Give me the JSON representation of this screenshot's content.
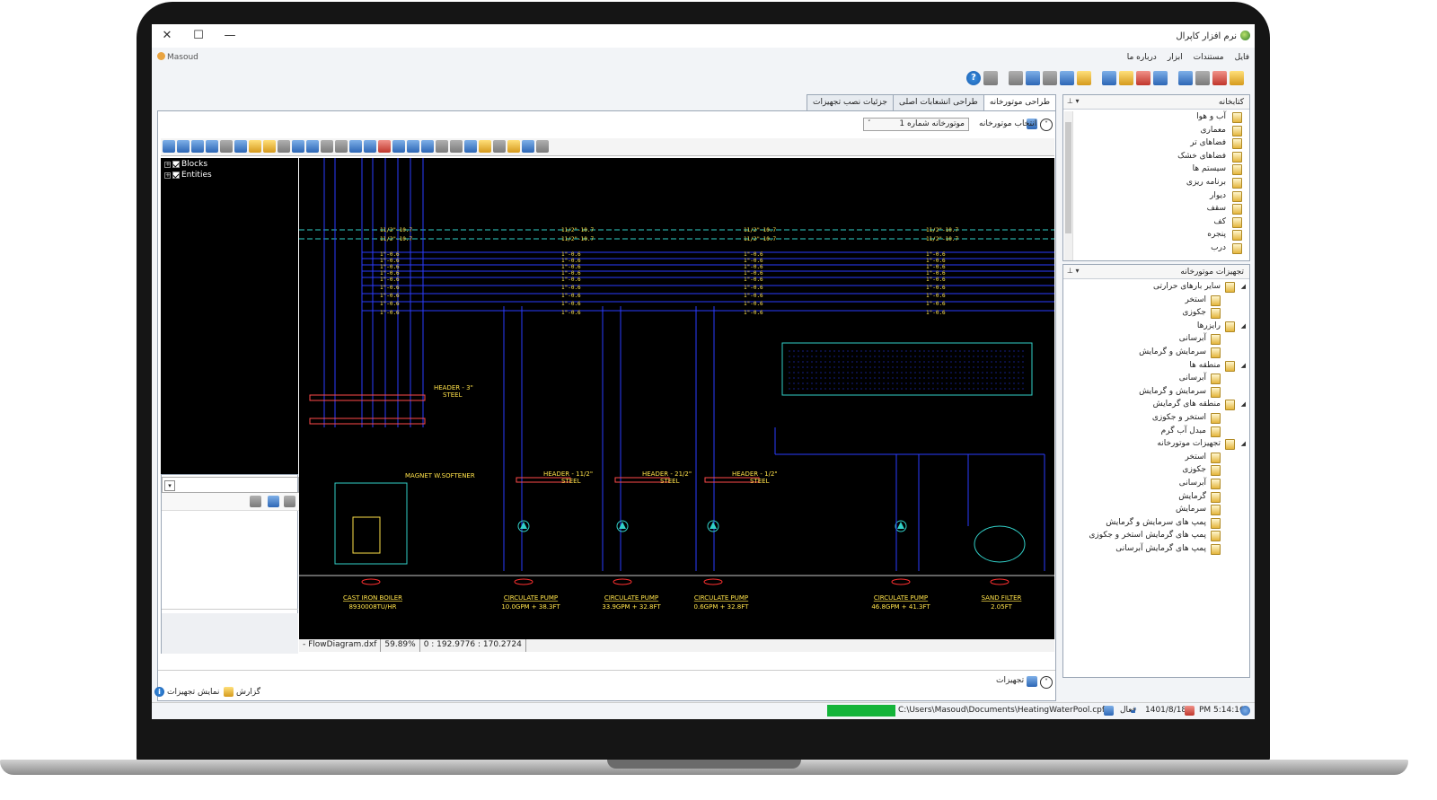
{
  "window": {
    "title": "نرم افزار کاپرال",
    "controls": {
      "close": "✕",
      "maximize": "☐",
      "minimize": "—"
    }
  },
  "user": {
    "name": "Masoud"
  },
  "menu": [
    "فایل",
    "مستندات",
    "ابزار",
    "درباره ما"
  ],
  "tabs": [
    "طراحی موتورخانه",
    "طراحی انشعابات اصلی",
    "جزئیات نصب تجهیزات"
  ],
  "library_panel": {
    "title": "کتابخانه",
    "items": [
      "آب و هوا",
      "معماری",
      "فضاهای تر",
      "فضاهای خشک",
      "سیستم ها",
      "برنامه ریزی",
      "دیوار",
      "سقف",
      "کف",
      "پنجره",
      "درب"
    ]
  },
  "equipment_panel": {
    "title": "تجهیزات موتورخانه",
    "items": [
      {
        "label": "سایر بارهای حرارتی",
        "level": 0
      },
      {
        "label": "استخر",
        "level": 1
      },
      {
        "label": "جکوزی",
        "level": 1
      },
      {
        "label": "رایزرها",
        "level": 0
      },
      {
        "label": "آبرسانی",
        "level": 1
      },
      {
        "label": "سرمایش و گرمایش",
        "level": 1
      },
      {
        "label": "منطقه ها",
        "level": 0
      },
      {
        "label": "آبرسانی",
        "level": 1
      },
      {
        "label": "سرمایش و گرمایش",
        "level": 1
      },
      {
        "label": "منطقه های گرمایش",
        "level": 0
      },
      {
        "label": "استخر و جکوزی",
        "level": 1
      },
      {
        "label": "مبدل آب گرم",
        "level": 1
      },
      {
        "label": "تجهیزات موتورخانه",
        "level": 0
      },
      {
        "label": "استخر",
        "level": 1
      },
      {
        "label": "جکوزی",
        "level": 1
      },
      {
        "label": "آبرسانی",
        "level": 1
      },
      {
        "label": "گرمایش",
        "level": 1
      },
      {
        "label": "سرمایش",
        "level": 1
      },
      {
        "label": "پمپ های سرمایش و گرمایش",
        "level": 1
      },
      {
        "label": "پمپ های گرمایش استخر و جکوزی",
        "level": 1
      },
      {
        "label": "پمپ های گرمایش آبرسانی",
        "level": 1
      }
    ]
  },
  "select_plant": {
    "label": "انتخاب موتورخانه",
    "value": "موتورخانه شماره 1"
  },
  "layers": [
    "Blocks",
    "Entities"
  ],
  "cad_status": {
    "file": "- FlowDiagram.dxf",
    "zoom": "59.89%",
    "coords": "0 : 192.9776 : 170.2724"
  },
  "equipment_row_label": "تجهیزات",
  "footer": {
    "show_equipment": "نمایش تجهیزات",
    "report": "گزارش"
  },
  "statusbar": {
    "path": "C:\\Users\\Masoud\\Documents\\HeatingWaterPool.cpf",
    "state": "فعال",
    "date": "1401/8/18",
    "time": "PM 5:14:16"
  },
  "drawing": {
    "labels": [
      {
        "name": "CAST IRON BOILER",
        "spec": "8930008TU/HR"
      },
      {
        "name": "CIRCULATE PUMP",
        "spec": "10.0GPM + 38.3FT"
      },
      {
        "name": "CIRCULATE PUMP",
        "spec": "33.9GPM + 32.8FT"
      },
      {
        "name": "CIRCULATE PUMP",
        "spec": "0.6GPM + 32.8FT"
      },
      {
        "name": "CIRCULATE PUMP",
        "spec": "46.8GPM + 41.3FT"
      },
      {
        "name": "SAND FILTER",
        "spec": "2.05FT"
      }
    ],
    "headers": [
      "HEADER - 3\"",
      "HEADER - 11/2\"",
      "HEADER - 21/2\"",
      "HEADER - 1/2\""
    ],
    "softener": "MAGNET W.SOFTENER",
    "steel": "STEEL"
  },
  "colors": {
    "accent": "#14b43a",
    "canvas": "#000000",
    "pipe_blue": "#2a3cff",
    "pipe_cyan": "#32d0c8",
    "text_yellow": "#ffe24a"
  }
}
